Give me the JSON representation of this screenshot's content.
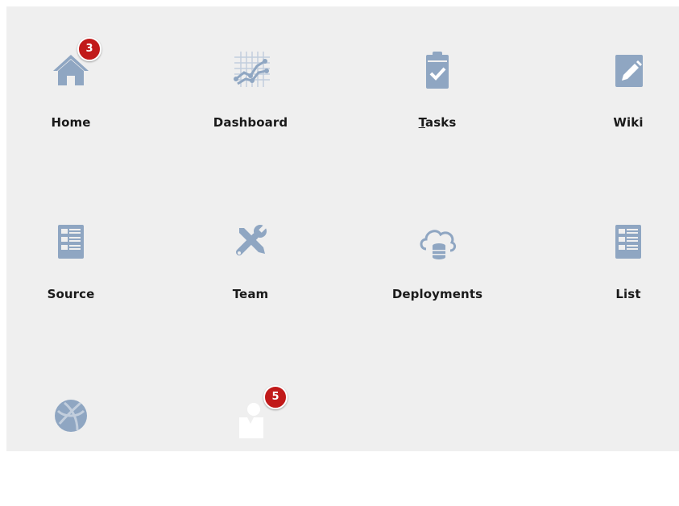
{
  "colors": {
    "background": "#efefef",
    "icon": "#8fa6c2",
    "icon_light": "#c2cedd",
    "badge": "#c11a1a",
    "label": "#1a1a1a"
  },
  "tiles": [
    {
      "label": "Home",
      "icon": "home-icon",
      "badge": "3"
    },
    {
      "label": "Dashboard",
      "icon": "chart-grid-icon"
    },
    {
      "label_first": "T",
      "label_rest": "asks",
      "icon": "clipboard-check-icon"
    },
    {
      "label": "Wiki",
      "icon": "pencil-icon"
    },
    {
      "label": "Source",
      "icon": "list-document-icon"
    },
    {
      "label": "Team",
      "icon": "tools-icon"
    },
    {
      "label": "Deployments",
      "icon": "cloud-database-icon"
    },
    {
      "label": "List",
      "icon": "list-document-icon"
    },
    {
      "label": "",
      "icon": "globe-icon"
    },
    {
      "label": "",
      "icon": "user-icon",
      "badge": "5"
    }
  ]
}
